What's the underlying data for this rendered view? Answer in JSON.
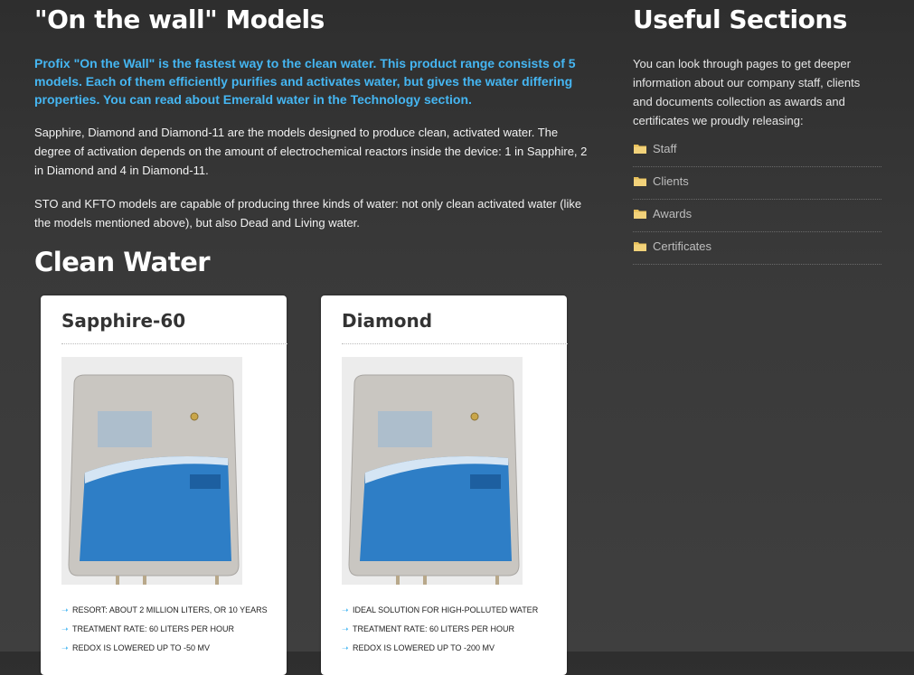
{
  "main": {
    "title": "\"On the wall\" Models",
    "lead": "Profix \"On the Wall\" is the fastest way to the clean water. This product range consists of 5 models. Each of them efficiently purifies and activates water, but gives the water differing properties. You can read about Emerald water in the Technology section.",
    "paragraph1": "Sapphire, Diamond and Diamond-11 are the models designed to produce clean, activated water. The degree of activation depends on the amount of electrochemical reactors inside the device: 1 in Sapphire, 2 in Diamond and 4 in Diamond-11.",
    "paragraph2": "STO and KFTO models are capable of producing three kinds of water: not only clean activated water (like the models mentioned above), but also Dead and Living water.",
    "section_title": "Clean Water",
    "products": [
      {
        "name": "Sapphire-60",
        "image_icon": "water-purifier-image",
        "features": [
          "Resort: about 2 million liters, or 10 years",
          "Treatment rate: 60 liters per hour",
          "Redox is lowered up to -50 mV"
        ]
      },
      {
        "name": "Diamond",
        "image_icon": "water-purifier-image",
        "features": [
          "Ideal solution for high-polluted water",
          "Treatment rate: 60 liters per hour",
          "Redox is lowered up to -200 mV"
        ]
      }
    ]
  },
  "sidebar": {
    "title": "Useful Sections",
    "intro": "You can look through pages to get deeper information about our company staff, clients and documents collection as awards and certificates we proudly releasing:",
    "links": [
      {
        "label": "Staff",
        "icon": "folder-icon"
      },
      {
        "label": "Clients",
        "icon": "folder-icon"
      },
      {
        "label": "Awards",
        "icon": "folder-icon"
      },
      {
        "label": "Certificates",
        "icon": "folder-icon"
      }
    ]
  },
  "colors": {
    "accent": "#45b6f2",
    "background": "#3a3a3a",
    "card": "#ffffff",
    "folder": "#e8c05a"
  }
}
